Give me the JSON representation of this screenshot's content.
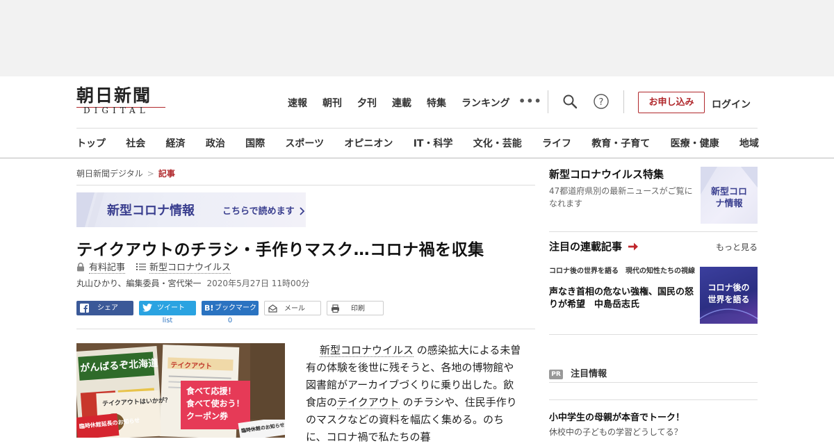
{
  "logo": {
    "main": "朝日新聞",
    "sub": "DIGITAL"
  },
  "topnav": [
    "速報",
    "朝刊",
    "夕刊",
    "連載",
    "特集",
    "ランキング"
  ],
  "header_actions": {
    "more": "•••",
    "apply_label": "お申し込み",
    "login_label": "ログイン"
  },
  "catnav": [
    "トップ",
    "社会",
    "経済",
    "政治",
    "国際",
    "スポーツ",
    "オピニオン",
    "IT・科学",
    "文化・芸能",
    "ライフ",
    "教育・子育て",
    "医療・健康",
    "地域"
  ],
  "breadcrumb": {
    "home": "朝日新聞デジタル",
    "sep": ">",
    "current": "記事"
  },
  "corona_banner": {
    "title": "新型コロナ情報",
    "link": "こちらで読めます"
  },
  "article": {
    "title": "テイクアウトのチラシ・手作りマスク…コロナ禍を収集",
    "tag_paid": "有料記事",
    "tag_topic": "新型コロナウイルス",
    "authors": "丸山ひかり、編集委員・宮代栄一",
    "date": "2020年5月27日 11時00分",
    "body": {
      "p1_link1": "新型コロナウイルス",
      "p1_text1": "の感染拡大による未曽有の体験を後世に残そうと、各地の博物館や図書館がアーカイブづくりに乗り出した。飲食店の",
      "p1_link2": "テイクアウト",
      "p1_text2": "のチラシや、住民手作りのマスクなどの資料を幅広く集める。のちに、コロナ禍で私たちの暮"
    },
    "photo": {
      "flyer1": "がんばるぞ北海道",
      "flyer2": "テイクアウト",
      "flyer3_l1": "食べて応援！",
      "flyer3_l2": "食べて使おう！",
      "flyer3_l3": "クーポン券",
      "flyer4": "臨時休館延長のお知らせ",
      "flyer5": "臨時休館のお知らせ",
      "flyer6": "テイクアウトはいかが？"
    }
  },
  "share": {
    "facebook": "シェア",
    "twitter": "ツイート",
    "twitter_count": "list",
    "hatena": "ブックマーク",
    "hatena_count": "0",
    "mail": "メール",
    "print": "印刷"
  },
  "sidebar": {
    "feature": {
      "title": "新型コロナウイルス特集",
      "desc": "47都道府県別の最新ニュースがご覧になれます",
      "thumb_label": "新型コロナ情報"
    },
    "series": {
      "heading": "注目の連載記事",
      "more": "もっと見る",
      "kicker": "コロナ後の世界を語る　現代の知性たちの視線",
      "title": "声なき首相の危ない強権、国民の怒りが希望　中島岳志氏",
      "thumb_label": "コロナ後の世界を語る"
    },
    "pr": {
      "badge": "PR",
      "label": "注目情報"
    },
    "promo": {
      "title": "小中学生の母親が本音でトーク！",
      "desc": "休校中の子どもの学習どうしてる？"
    }
  },
  "colors": {
    "brand_red": "#b0272b",
    "facebook": "#3b5998",
    "twitter": "#2aa3e1",
    "hatena": "#2a73c1",
    "corona_purple": "#3a3f8f"
  }
}
